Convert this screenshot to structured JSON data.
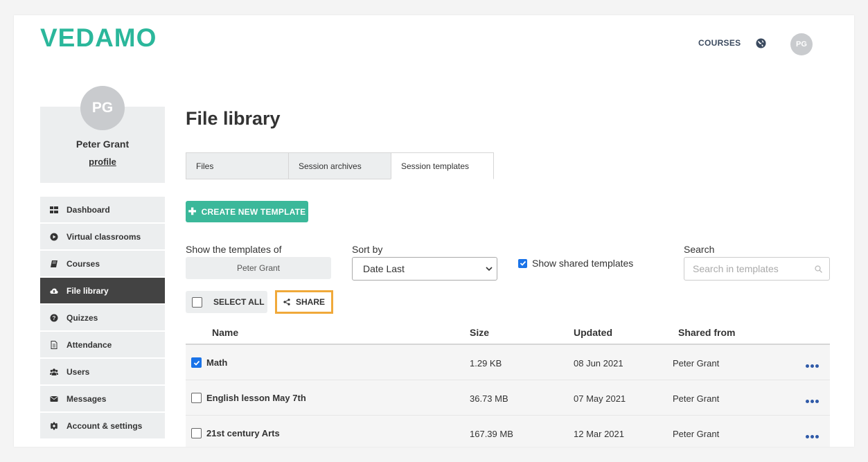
{
  "brand": {
    "logo": "VEDAMO",
    "accent": "#2bb79b"
  },
  "topnav": {
    "courses": "COURSES",
    "avatar_initials": "PG"
  },
  "profile": {
    "initials": "PG",
    "name": "Peter Grant",
    "link": "profile"
  },
  "sidebar": {
    "items": [
      {
        "label": "Dashboard",
        "icon": "grid-icon"
      },
      {
        "label": "Virtual classrooms",
        "icon": "play-circle-icon"
      },
      {
        "label": "Courses",
        "icon": "book-icon"
      },
      {
        "label": "File library",
        "icon": "cloud-upload-icon",
        "active": true
      },
      {
        "label": "Quizzes",
        "icon": "question-circle-icon"
      },
      {
        "label": "Attendance",
        "icon": "document-icon"
      },
      {
        "label": "Users",
        "icon": "users-icon"
      },
      {
        "label": "Messages",
        "icon": "envelope-icon"
      },
      {
        "label": "Account & settings",
        "icon": "gear-icon"
      }
    ]
  },
  "main": {
    "title": "File library",
    "tabs": [
      {
        "label": "Files"
      },
      {
        "label": "Session archives"
      },
      {
        "label": "Session templates",
        "active": true
      }
    ],
    "create_button": "CREATE NEW TEMPLATE",
    "filters": {
      "show_of_label": "Show the templates of",
      "show_of_value": "Peter Grant",
      "sort_label": "Sort by",
      "sort_value": "Date Last",
      "shared_label": "Show shared templates",
      "shared_checked": true,
      "search_label": "Search",
      "search_placeholder": "Search in templates"
    },
    "select_all": "SELECT ALL",
    "share": "SHARE",
    "table": {
      "columns": [
        "Name",
        "Size",
        "Updated",
        "Shared from"
      ],
      "rows": [
        {
          "name": "Math",
          "size": "1.29 KB",
          "updated": "08 Jun 2021",
          "shared_from": "Peter Grant",
          "checked": true
        },
        {
          "name": "English lesson May 7th",
          "size": "36.73 MB",
          "updated": "07 May 2021",
          "shared_from": "Peter Grant",
          "checked": false
        },
        {
          "name": "21st century Arts",
          "size": "167.39 MB",
          "updated": "12 Mar 2021",
          "shared_from": "Peter Grant",
          "checked": false
        }
      ]
    }
  }
}
